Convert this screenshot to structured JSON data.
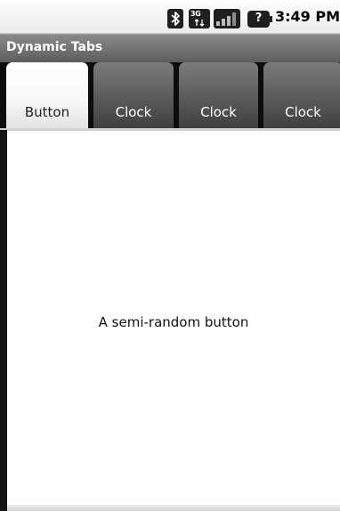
{
  "status_bar": {
    "time": "3:49 PM",
    "network_label": "3G",
    "icons": [
      "bluetooth-icon",
      "network-3g-icon",
      "signal-strength-icon",
      "battery-unknown-icon"
    ],
    "battery_glyph": "?"
  },
  "app": {
    "title": "Dynamic Tabs"
  },
  "tabs": [
    {
      "label": "Button",
      "selected": true
    },
    {
      "label": "Clock",
      "selected": false
    },
    {
      "label": "Clock",
      "selected": false
    },
    {
      "label": "Clock",
      "selected": false
    }
  ],
  "content": {
    "button_label": "A semi-random button"
  },
  "colors": {
    "title_bar": "#6e6e6e",
    "tab_selected": "#f7f7f7",
    "tab_unselected": "#5a5a5a",
    "tab_strip_background": "#0c0c0c"
  }
}
